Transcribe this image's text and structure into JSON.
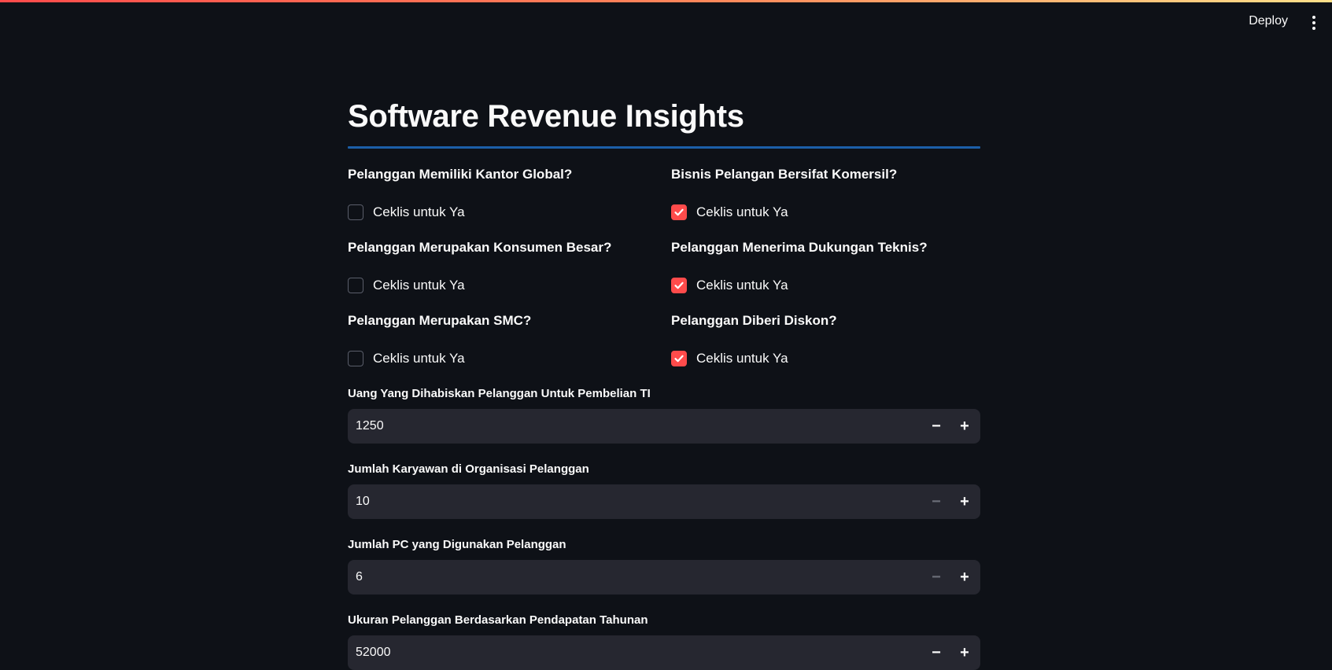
{
  "header": {
    "deploy_label": "Deploy"
  },
  "page": {
    "title": "Software Revenue Insights"
  },
  "questions": [
    {
      "label": "Pelanggan Memiliki Kantor Global?",
      "checkbox_label": "Ceklis untuk Ya",
      "checked": false
    },
    {
      "label": "Bisnis Pelangan Bersifat Komersil?",
      "checkbox_label": "Ceklis untuk Ya",
      "checked": true
    },
    {
      "label": "Pelanggan Merupakan Konsumen Besar?",
      "checkbox_label": "Ceklis untuk Ya",
      "checked": false
    },
    {
      "label": "Pelanggan Menerima Dukungan Teknis?",
      "checkbox_label": "Ceklis untuk Ya",
      "checked": true
    },
    {
      "label": "Pelanggan Merupakan SMC?",
      "checkbox_label": "Ceklis untuk Ya",
      "checked": false
    },
    {
      "label": "Pelanggan Diberi Diskon?",
      "checkbox_label": "Ceklis untuk Ya",
      "checked": true
    }
  ],
  "numbers": [
    {
      "label": "Uang Yang Dihabiskan Pelanggan Untuk Pembelian TI",
      "value": "1250",
      "minus_enabled": true
    },
    {
      "label": "Jumlah Karyawan di Organisasi Pelanggan",
      "value": "10",
      "minus_enabled": false
    },
    {
      "label": "Jumlah PC yang Digunakan Pelanggan",
      "value": "6",
      "minus_enabled": false
    },
    {
      "label": "Ukuran Pelanggan Berdasarkan Pendapatan Tahunan",
      "value": "52000",
      "minus_enabled": true
    }
  ],
  "stepper": {
    "minus_symbol": "−",
    "plus_symbol": "+"
  },
  "colors": {
    "accent": "#ff4b4b",
    "background": "#0e1117",
    "input_background": "#262730",
    "divider": "#1c5fa8"
  }
}
